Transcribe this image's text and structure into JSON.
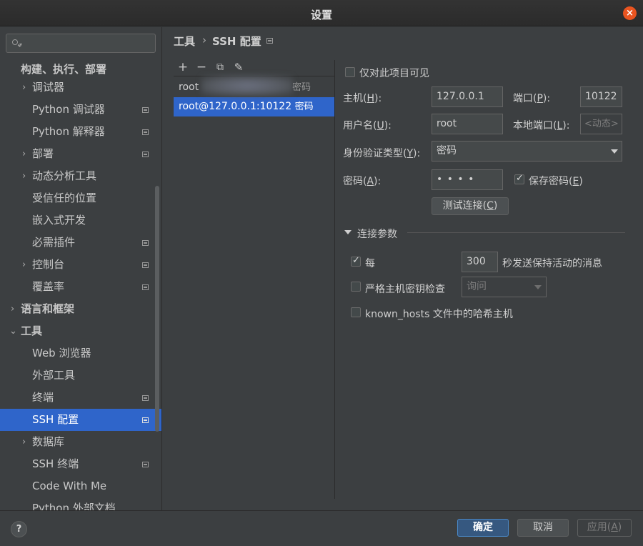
{
  "window": {
    "title": "设置",
    "close_icon": "×"
  },
  "search": {
    "placeholder": ""
  },
  "sidebar": {
    "section_build": "构建、执行、部署",
    "items": [
      {
        "label": "调试器"
      },
      {
        "label": "Python 调试器"
      },
      {
        "label": "Python 解释器"
      },
      {
        "label": "部署"
      },
      {
        "label": "动态分析工具"
      },
      {
        "label": "受信任的位置"
      },
      {
        "label": "嵌入式开发"
      },
      {
        "label": "必需插件"
      },
      {
        "label": "控制台"
      },
      {
        "label": "覆盖率"
      },
      {
        "label": "语言和框架"
      },
      {
        "label": "工具"
      },
      {
        "label": "Web 浏览器"
      },
      {
        "label": "外部工具"
      },
      {
        "label": "终端"
      },
      {
        "label": "SSH 配置"
      },
      {
        "label": "数据库"
      },
      {
        "label": "SSH 终端"
      },
      {
        "label": "Code With Me"
      },
      {
        "label": "Python 外部文档"
      }
    ],
    "selected": "SSH 配置"
  },
  "breadcrumb": {
    "parent": "工具",
    "separator": "›",
    "current": "SSH 配置"
  },
  "toolbar": {
    "add": "+",
    "remove": "−",
    "copy": "⧉",
    "edit": "✎"
  },
  "hosts": [
    {
      "name": "root",
      "auth": "密码",
      "selected": false
    },
    {
      "name": "root@127.0.0.1:10122",
      "auth": "密码",
      "selected": true
    }
  ],
  "form": {
    "project_only_label": "仅对此项目可见",
    "host_label_pre": "主机(",
    "host_label_key": "H",
    "host_label_post": "):",
    "host_value": "127.0.0.1",
    "port_label_pre": "端口(",
    "port_label_key": "P",
    "port_label_post": "):",
    "port_value": "10122",
    "username_label_pre": "用户名(",
    "username_label_key": "U",
    "username_label_post": "):",
    "username_value": "root",
    "local_port_label_pre": "本地端口(",
    "local_port_label_key": "L",
    "local_port_label_post": "):",
    "local_port_placeholder": "<动态>",
    "auth_type_label_pre": "身份验证类型(",
    "auth_type_label_key": "Y",
    "auth_type_label_post": "):",
    "auth_type_value": "密码",
    "password_label_pre": "密码(",
    "password_label_key": "A",
    "password_label_post": "):",
    "password_mask": "• • • •",
    "save_password_pre": "保存密码(",
    "save_password_key": "E",
    "save_password_post": ")",
    "save_password_checked": true,
    "test_button_pre": "测试连接(",
    "test_button_key": "C",
    "test_button_post": ")"
  },
  "connection": {
    "section_title": "连接参数",
    "keepalive_prefix": "每",
    "keepalive_value": "300",
    "keepalive_suffix": "秒发送保持活动的消息",
    "keepalive_checked": true,
    "strict_label": "严格主机密钥检查",
    "strict_value": "询问",
    "strict_checked": false,
    "hash_label": "known_hosts 文件中的哈希主机",
    "hash_checked": false
  },
  "footer": {
    "help": "?",
    "ok": "确定",
    "cancel": "取消",
    "apply_pre": "应用(",
    "apply_key": "A",
    "apply_post": ")"
  },
  "colors": {
    "accent": "#2f65ca",
    "close": "#e95420",
    "primary_button": "#365880"
  }
}
